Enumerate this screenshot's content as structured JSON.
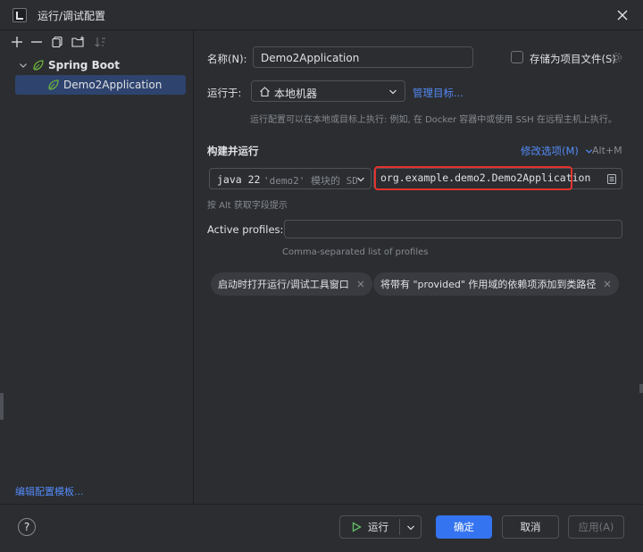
{
  "window": {
    "title": "运行/调试配置"
  },
  "sidebar": {
    "tree": {
      "root_label": "Spring Boot",
      "child_label": "Demo2Application"
    },
    "edit_templates": "编辑配置模板..."
  },
  "form": {
    "name_label": "名称(N):",
    "name_value": "Demo2Application",
    "store_as_project": "存储为项目文件(S)",
    "run_on_label": "运行于:",
    "run_on_value": "本地机器",
    "manage_targets": "管理目标...",
    "run_on_hint": "运行配置可以在本地或目标上执行: 例如, 在 Docker 容器中或使用 SSH 在远程主机上执行。",
    "build_section": "构建并运行",
    "modify_options": "修改选项(M)",
    "modify_shortcut": "Alt+M",
    "jdk_prefix": "java 22",
    "jdk_module": "'demo2' 模块的 SD",
    "main_class": "org.example.demo2.Demo2Application",
    "field_hint": "按 Alt 获取字段提示",
    "profiles_label": "Active profiles:",
    "profiles_value": "",
    "profiles_hint": "Comma-separated list of profiles",
    "chips": [
      "启动时打开运行/调试工具窗口",
      "将带有 \"provided\" 作用域的依赖项添加到类路径"
    ]
  },
  "footer": {
    "help": "?",
    "run": "运行",
    "ok": "确定",
    "cancel": "取消",
    "apply": "应用(A)"
  },
  "colors": {
    "accent": "#3574f0",
    "link": "#548af7",
    "selection": "#2e436e",
    "highlight_border": "#e5322d",
    "run_green": "#5fb865",
    "spring_green": "#6db33f"
  }
}
